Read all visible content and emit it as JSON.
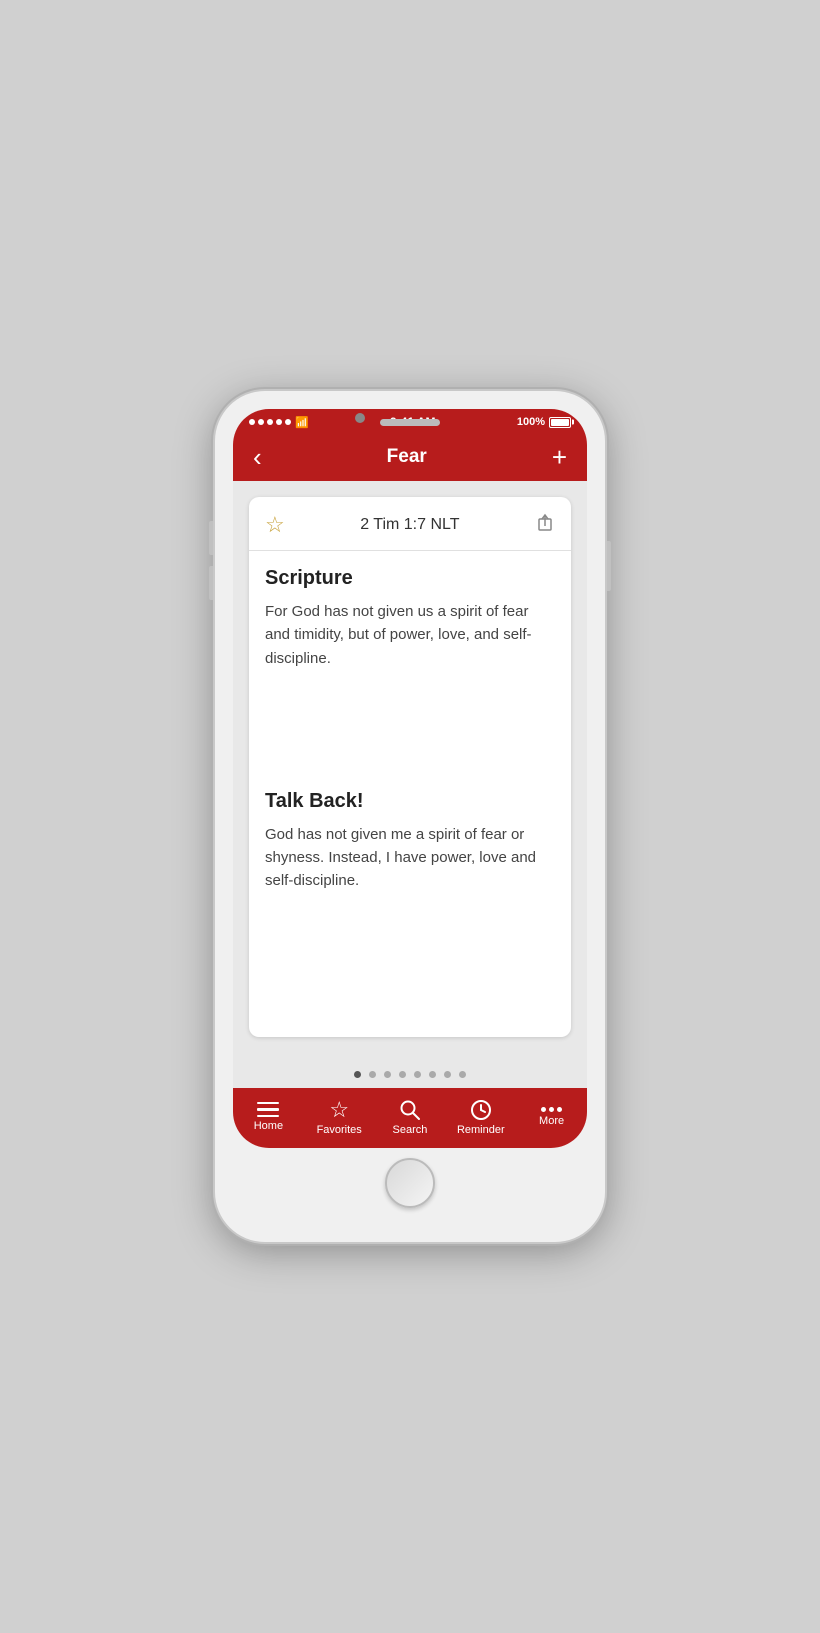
{
  "phone": {
    "status_bar": {
      "time": "9:41 AM",
      "battery_pct": "100%"
    },
    "nav": {
      "back_label": "‹",
      "title": "Fear",
      "add_label": "+"
    },
    "card": {
      "verse_ref": "2 Tim 1:7 NLT",
      "scripture_heading": "Scripture",
      "scripture_text": "For God has not given us a spirit of fear and timidity, but of power, love, and self-discipline.",
      "talk_back_heading": "Talk Back!",
      "talk_back_text": "God has not given me a spirit of fear or shyness. Instead, I have power, love and self-discipline."
    },
    "pagination": {
      "total": 8,
      "active_index": 0
    },
    "tabs": [
      {
        "id": "home",
        "label": "Home",
        "icon": "home-icon"
      },
      {
        "id": "favorites",
        "label": "Favorites",
        "icon": "star-icon"
      },
      {
        "id": "search",
        "label": "Search",
        "icon": "search-icon"
      },
      {
        "id": "reminder",
        "label": "Reminder",
        "icon": "clock-icon"
      },
      {
        "id": "more",
        "label": "More",
        "icon": "dots-icon"
      }
    ],
    "colors": {
      "primary": "#b71c1c",
      "tab_bar": "#b71c1c"
    }
  }
}
